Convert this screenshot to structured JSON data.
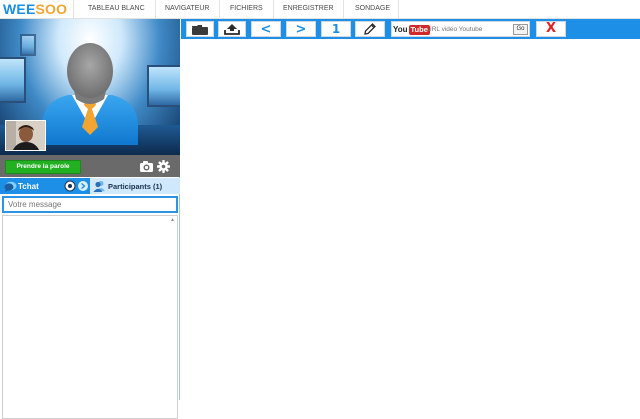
{
  "app": {
    "logo_part1": "WEE",
    "logo_part2": "SOO"
  },
  "nav": [
    {
      "label": "TABLEAU BLANC"
    },
    {
      "label": "NAVIGATEUR"
    },
    {
      "label": "FICHIERS"
    },
    {
      "label": "ENREGISTRER"
    },
    {
      "label": "SONDAGE"
    }
  ],
  "video": {
    "speak_button": "Prendre la parole"
  },
  "chat": {
    "tab_tchat": "Tchat",
    "tab_participants": "Participants (1)",
    "message_placeholder": "Votre message"
  },
  "toolbar": {
    "prev_label": "<",
    "next_label": ">",
    "page_number": "1",
    "youtube_you": "You",
    "youtube_tube": "Tube",
    "youtube_placeholder": "URL vidéo Youtube",
    "go_label": "Go",
    "close_label": "X"
  },
  "colors": {
    "brand_blue": "#1d8fe6",
    "brand_orange": "#f2a531",
    "speak_green": "#22b022",
    "close_red": "#e12222"
  },
  "icons": [
    "folder-icon",
    "upload-icon",
    "pencil-icon",
    "camera-icon",
    "gear-icon",
    "chat-bubble-icon",
    "participants-icon",
    "settings-small-icon",
    "arrow-right-icon"
  ]
}
